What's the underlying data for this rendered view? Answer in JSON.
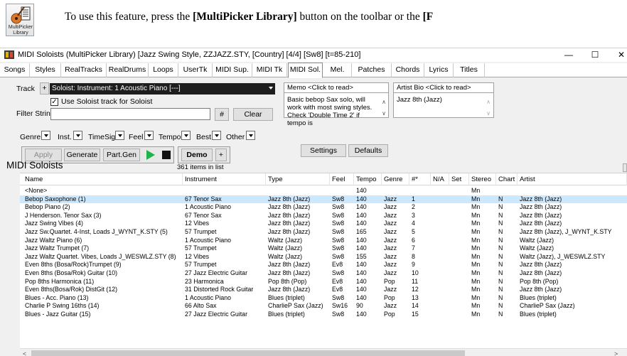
{
  "doc": {
    "icon_label": "MultiPicker Library",
    "text_pre": "To use this feature, press the ",
    "text_bold1": "[MultiPicker Library]",
    "text_mid": " button on the toolbar or the ",
    "text_bold2": "[F"
  },
  "window": {
    "title": "MIDI Soloists   (MultiPicker Library)  [Jazz Swing Style, ZZJAZZ.STY,  [Country] [4/4] [Sw8] [t=85-210]",
    "minimize": "—",
    "maximize": "☐",
    "close": "✕"
  },
  "tabs": [
    "Songs",
    "Styles",
    "RealTracks",
    "RealDrums",
    "Loops",
    "UserTk",
    "MIDI Sup.",
    "MIDI Tk",
    "MIDI Sol.",
    "Mel.",
    "Patches",
    "Chords",
    "Lyrics",
    "Titles"
  ],
  "active_tab": "MIDI Sol.",
  "controls": {
    "track_label": "Track",
    "track_plus": "+",
    "track_value": "Soloist: Instrument: 1 Acoustic Piano [---]",
    "use_soloist_label": "Use Soloist track for Soloist",
    "use_soloist_checked": "✓",
    "filter_label": "Filter String",
    "filter_value": "",
    "hash_button": "#",
    "clear_button": "Clear",
    "memo_label": "Memo   <Click to read>",
    "memo_text": "Basic bebop Sax solo, will work with most swing styles. Check 'Double Time 2' if tempo is",
    "artist_bio_label": "Artist Bio   <Click to read>",
    "artist_bio_text": "Jazz 8th (Jazz)",
    "filters": [
      "Genre",
      "Inst.",
      "TimeSig",
      "Feel",
      "Tempo",
      "Best",
      "Other"
    ],
    "apply": "Apply",
    "generate": "Generate",
    "part_gen": "Part.Gen",
    "demo": "Demo",
    "demo_plus": "+",
    "settings": "Settings",
    "defaults": "Defaults"
  },
  "list": {
    "title": "MIDI Soloists",
    "count": "361 items in list",
    "columns": [
      "Name",
      "Instrument",
      "Type",
      "Feel",
      "Tempo",
      "Genre",
      "#*",
      "N/A",
      "Set",
      "Stereo",
      "Chart",
      "Artist"
    ],
    "rows": [
      [
        "<None>",
        "",
        "",
        "",
        "140",
        "",
        "",
        "",
        "",
        "Mn",
        "",
        ""
      ],
      [
        "Bebop Saxophone  (1)",
        "67 Tenor Sax",
        "Jazz 8th (Jazz)",
        "Sw8",
        "140",
        "Jazz",
        "1",
        "",
        "",
        "Mn",
        "N",
        "Jazz 8th (Jazz)"
      ],
      [
        "Bebop Piano  (2)",
        "1 Acoustic Piano",
        "Jazz 8th (Jazz)",
        "Sw8",
        "140",
        "Jazz",
        "2",
        "",
        "",
        "Mn",
        "N",
        "Jazz 8th (Jazz)"
      ],
      [
        "J Henderson. Tenor Sax  (3)",
        "67 Tenor Sax",
        "Jazz 8th (Jazz)",
        "Sw8",
        "140",
        "Jazz",
        "3",
        "",
        "",
        "Mn",
        "N",
        "Jazz 8th (Jazz)"
      ],
      [
        "Jazz Swing Vibes  (4)",
        "12 Vibes",
        "Jazz 8th (Jazz)",
        "Sw8",
        "140",
        "Jazz",
        "4",
        "",
        "",
        "Mn",
        "N",
        "Jazz 8th (Jazz)"
      ],
      [
        "Jazz Sw.Quartet. 4-Inst, Loads J_WYNT_K.STY  (5)",
        "57 Trumpet",
        "Jazz 8th (Jazz)",
        "Sw8",
        "165",
        "Jazz",
        "5",
        "",
        "",
        "Mn",
        "N",
        "Jazz 8th (Jazz), J_WYNT_K.STY"
      ],
      [
        "Jazz Waltz Piano  (6)",
        "1 Acoustic Piano",
        "Waltz (Jazz)",
        "Sw8",
        "140",
        "Jazz",
        "6",
        "",
        "",
        "Mn",
        "N",
        "Waltz (Jazz)"
      ],
      [
        "Jazz Waltz Trumpet  (7)",
        "57 Trumpet",
        "Waltz (Jazz)",
        "Sw8",
        "140",
        "Jazz",
        "7",
        "",
        "",
        "Mn",
        "N",
        "Waltz (Jazz)"
      ],
      [
        "Jazz Waltz Quartet. Vibes, Loads J_WESWLZ.STY  (8)",
        "12 Vibes",
        "Waltz (Jazz)",
        "Sw8",
        "155",
        "Jazz",
        "8",
        "",
        "",
        "Mn",
        "N",
        "Waltz (Jazz), J_WESWLZ.STY"
      ],
      [
        "Even 8ths (Bosa/Rock)Trumpet  (9)",
        "57 Trumpet",
        "Jazz 8th (Jazz)",
        "Ev8",
        "140",
        "Jazz",
        "9",
        "",
        "",
        "Mn",
        "N",
        "Jazz 8th (Jazz)"
      ],
      [
        "Even 8ths (Bosa/Rok) Guitar  (10)",
        "27 Jazz Electric Guitar",
        "Jazz 8th (Jazz)",
        "Sw8",
        "140",
        "Jazz",
        "10",
        "",
        "",
        "Mn",
        "N",
        "Jazz 8th (Jazz)"
      ],
      [
        "Pop 8ths Harmonica  (11)",
        "23 Harmonica",
        "Pop 8th (Pop)",
        "Ev8",
        "140",
        "Pop",
        "11",
        "",
        "",
        "Mn",
        "N",
        "Pop 8th (Pop)"
      ],
      [
        "Even 8ths(Bosa/Rok) DistGit  (12)",
        "31 Distorted Rock Guitar",
        "Jazz 8th (Jazz)",
        "Ev8",
        "140",
        "Jazz",
        "12",
        "",
        "",
        "Mn",
        "N",
        "Jazz 8th (Jazz)"
      ],
      [
        "Blues - Acc. Piano  (13)",
        "1 Acoustic Piano",
        "Blues (triplet)",
        "Sw8",
        "140",
        "Pop",
        "13",
        "",
        "",
        "Mn",
        "N",
        "Blues (triplet)"
      ],
      [
        "Charlie P Swing 16ths  (14)",
        "66 Alto Sax",
        "CharlieP Sax (Jazz)",
        "Sw16",
        "90",
        "Jazz",
        "14",
        "",
        "",
        "Mn",
        "N",
        "CharlieP Sax (Jazz)"
      ],
      [
        "Blues - Jazz Guitar  (15)",
        "27 Jazz Electric Guitar",
        "Blues (triplet)",
        "Sw8",
        "140",
        "Pop",
        "15",
        "",
        "",
        "Mn",
        "N",
        "Blues (triplet)"
      ]
    ],
    "selected_row": 1,
    "scroll_left": "<",
    "scroll_right": ">"
  },
  "colors": {
    "selection": "#cce8ff",
    "track_bg": "#1e1e1e",
    "play": "#1fb24a"
  },
  "icons": [
    "multipicker-guitar-icon",
    "app-icon",
    "play-icon",
    "stop-icon",
    "checkbox-check-icon",
    "scroll-arrow-icon"
  ]
}
